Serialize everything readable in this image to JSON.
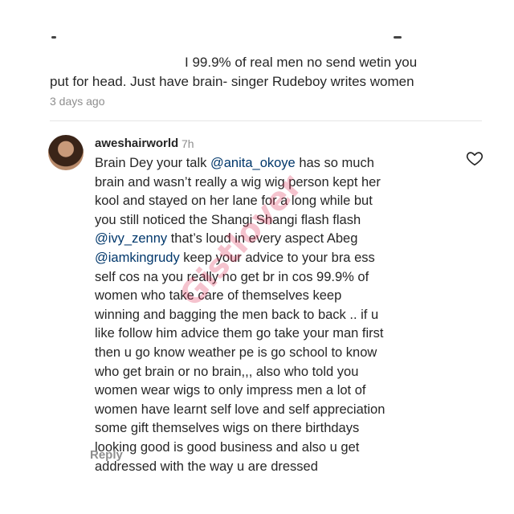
{
  "post": {
    "caption_line1_visible": "I 99.9% of real men no send wetin you",
    "caption_line2": "put for head. Just have brain- singer Rudeboy writes women",
    "time": "3 days ago"
  },
  "comment": {
    "username": "aweshairworld",
    "time": "7h",
    "lines": [
      [
        {
          "t": "Brain Dey your talk "
        },
        {
          "t": "@anita_okoye",
          "m": true
        },
        {
          "t": " has so much"
        }
      ],
      [
        {
          "t": "brain and wasn’t really a wig wig person kept her"
        }
      ],
      [
        {
          "t": "kool and stayed on her lane for a long while but"
        }
      ],
      [
        {
          "t": "you still noticed the Shangi Shangi flash flash"
        }
      ],
      [
        {
          "t": "@ivy_zenny",
          "m": true
        },
        {
          "t": " that’s loud in every aspect Abeg"
        }
      ],
      [
        {
          "t": "@iamkingrudy",
          "m": true
        },
        {
          "t": " keep your advice to your bra  ess"
        }
      ],
      [
        {
          "t": "self cos na you really no get br in cos 99.9% of"
        }
      ],
      [
        {
          "t": "women who take care of themselves keep"
        }
      ],
      [
        {
          "t": "winning and bagging the men back to back .. if u"
        }
      ],
      [
        {
          "t": "like follow him advice them go take your man first"
        }
      ],
      [
        {
          "t": "then u go know weather pe  is go school to know"
        }
      ],
      [
        {
          "t": "who get brain or no brain,,, also who told you"
        }
      ],
      [
        {
          "t": "women wear wigs to only impress men a lot of"
        }
      ],
      [
        {
          "t": "women have learnt self love and self appreciation"
        }
      ],
      [
        {
          "t": "some gift themselves wigs on there birthdays"
        }
      ],
      [
        {
          "t": "looking good is good business and also u get"
        }
      ],
      [
        {
          "t": "addressed with the way u are dressed"
        }
      ]
    ],
    "reply_label": "Reply"
  },
  "watermark": "Gistlover",
  "colors": {
    "mention": "#00376b",
    "muted": "#8e8e8e",
    "text": "#262626"
  },
  "icons": {
    "like": "heart-outline-icon"
  }
}
